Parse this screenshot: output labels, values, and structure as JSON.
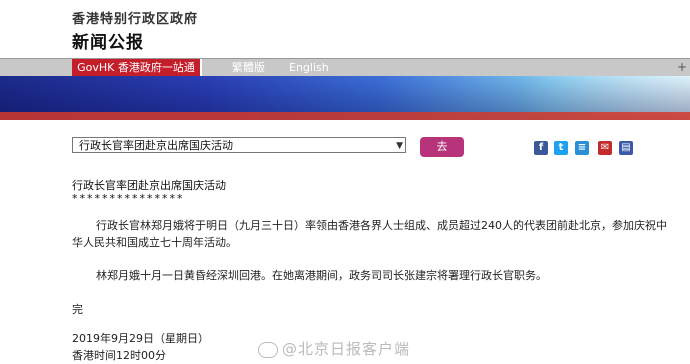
{
  "header": {
    "org": "香港特别行政区政府",
    "section": "新闻公报"
  },
  "nav": {
    "govhk": "GovHK 香港政府一站通",
    "traditional": "繁體版",
    "english": "English",
    "expand_symbol": "+"
  },
  "search": {
    "selected": "行政长官率团赴京出席国庆活动",
    "go_label": "去"
  },
  "share": {
    "facebook": "f",
    "twitter": "t",
    "other": "≡",
    "mail": "✉",
    "print": "▤"
  },
  "article": {
    "headline": "行政长官率团赴京出席国庆活动",
    "stars": "***************",
    "para1": "行政长官林郑月娥将于明日（九月三十日）率领由香港各界人士组成、成员超过240人的代表团前赴北京，参加庆祝中华人民共和国成立七十周年活动。",
    "para2": "林郑月娥十月一日黄昏经深圳回港。在她离港期间，政务司司长张建宗将署理行政长官职务。",
    "end": "完",
    "date": "2019年9月29日（星期日）",
    "time": "香港时间12时00分"
  },
  "watermark": "@北京日报客户端"
}
